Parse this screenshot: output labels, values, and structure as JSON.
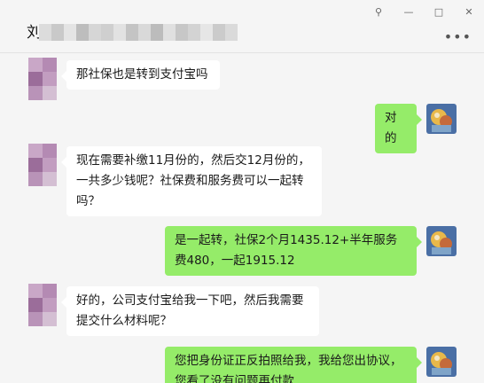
{
  "window": {
    "contact_name_visible": "刘",
    "controls": {
      "pin": "⚲",
      "minimize": "—",
      "maximize": "□",
      "close": "✕"
    },
    "more": "•••"
  },
  "messages": [
    {
      "direction": "in",
      "text": "那社保也是转到支付宝吗"
    },
    {
      "direction": "out",
      "text": "对的"
    },
    {
      "direction": "in",
      "text": "现在需要补缴11月份的，然后交12月份的，一共多少钱呢？社保费和服务费可以一起转吗？"
    },
    {
      "direction": "out",
      "text": "是一起转，社保2个月1435.12+半年服务费480，一起1915.12"
    },
    {
      "direction": "in",
      "text": "好的，公司支付宝给我一下吧，然后我需要提交什么材料呢？"
    },
    {
      "direction": "out",
      "text": "您把身份证正反拍照给我，我给您出协议，您看了没有问题再付款"
    }
  ],
  "colors": {
    "bubble_out": "#95ec69",
    "bubble_in": "#ffffff",
    "background": "#f5f5f5"
  }
}
